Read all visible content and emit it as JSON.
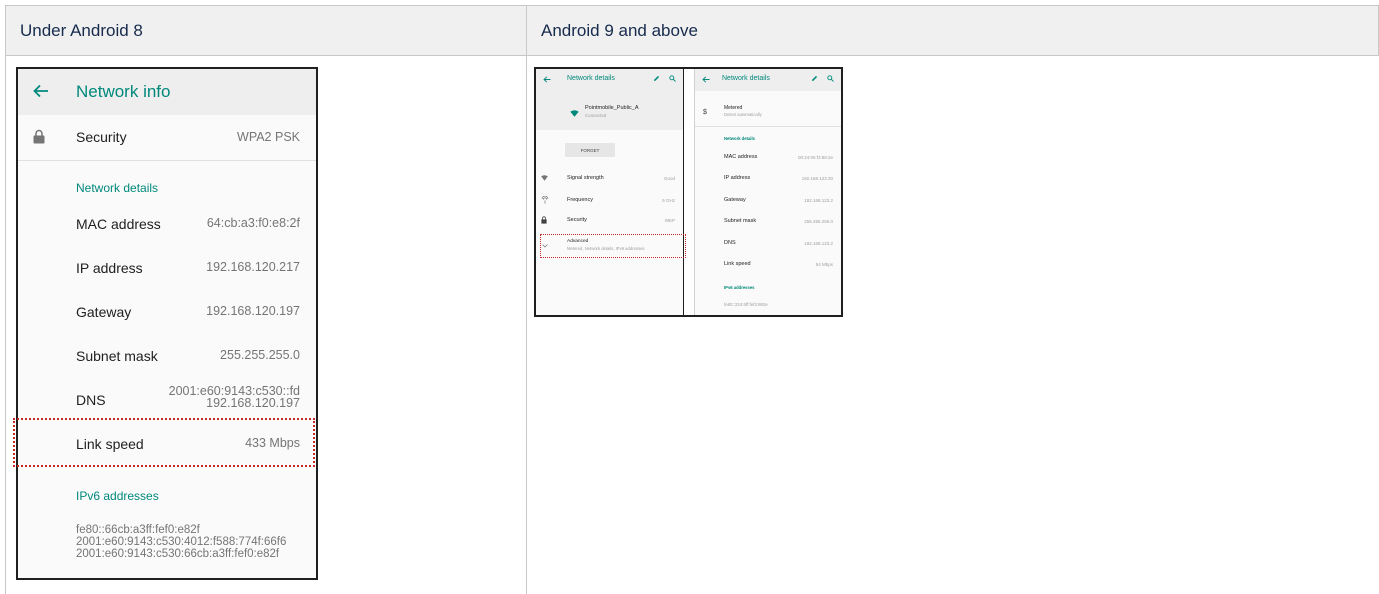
{
  "table": {
    "col1_header": "Under Android 8",
    "col2_header": "Android 9 and above"
  },
  "android8": {
    "title": "Network info",
    "security": {
      "label": "Security",
      "value": "WPA2 PSK"
    },
    "network_details_header": "Network details",
    "rows": [
      {
        "label": "MAC address",
        "value": "64:cb:a3:f0:e8:2f"
      },
      {
        "label": "IP address",
        "value": "192.168.120.217"
      },
      {
        "label": "Gateway",
        "value": "192.168.120.197"
      },
      {
        "label": "Subnet mask",
        "value": "255.255.255.0"
      },
      {
        "label": "DNS",
        "value_line1": "2001:e60:9143:c530::fd",
        "value_line2": "192.168.120.197"
      },
      {
        "label": "Link speed",
        "value": "433 Mbps"
      }
    ],
    "ipv6_header": "IPv6 addresses",
    "ipv6": [
      "fe80::66cb:a3ff:fef0:e82f",
      "2001:e60:9143:c530:4012:f588:774f:66f6",
      "2001:e60:9143:c530:66cb:a3ff:fef0:e82f"
    ]
  },
  "android9": {
    "left": {
      "title": "Network details",
      "network_name": "Pointmobile_Public_A",
      "network_status": "Connected",
      "forget": "FORGET",
      "rows": [
        {
          "label": "Signal strength",
          "value": "Good"
        },
        {
          "label": "Frequency",
          "value": "5 GHz"
        },
        {
          "label": "Security",
          "value": "WEP"
        }
      ],
      "advanced": {
        "label": "Advanced",
        "sub": "Metered, Network details, IPv6 addresses"
      }
    },
    "right": {
      "title": "Network details",
      "metered": {
        "label": "Metered",
        "sub": "Detect automatically"
      },
      "network_details_header": "Network details",
      "rows": [
        {
          "label": "MAC address",
          "value": "00:24:06:f3:88:2e"
        },
        {
          "label": "IP address",
          "value": "192.168.123.30"
        },
        {
          "label": "Gateway",
          "value": "192.168.123.2"
        },
        {
          "label": "Subnet mask",
          "value": "255.255.255.0"
        },
        {
          "label": "DNS",
          "value": "192.168.123.2"
        },
        {
          "label": "Link speed",
          "value": "54 Mbps"
        }
      ],
      "ipv6_header": "IPv6 addresses",
      "ipv6": "fe80::224:6ff:fef3:882e"
    }
  },
  "colors": {
    "accent": "#00897b",
    "highlight": "#c62828",
    "header_bg": "#f0f0f0"
  },
  "icons": [
    "back-arrow-icon",
    "lock-icon",
    "pencil-icon",
    "search-icon",
    "wifi-icon",
    "signal-icon",
    "frequency-icon",
    "chevron-down-icon",
    "dollar-icon"
  ]
}
